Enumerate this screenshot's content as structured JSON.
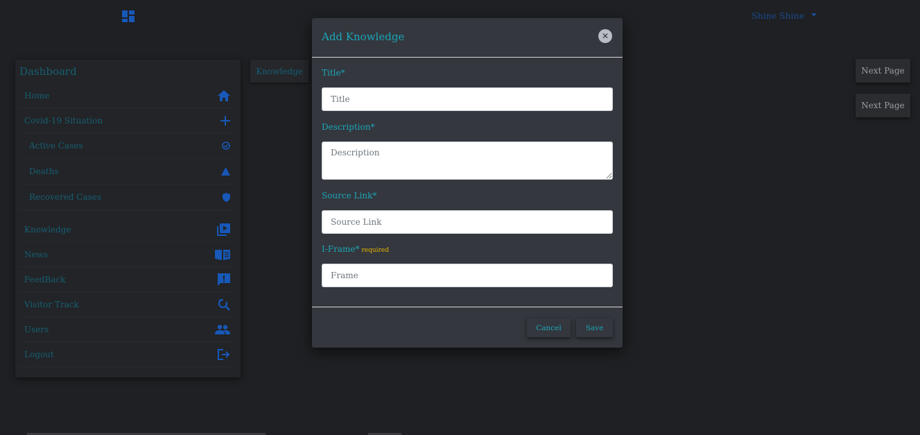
{
  "topbar": {
    "logo_icon": "dashboard-icon",
    "user_name": "Shine Shine"
  },
  "sidebar": {
    "title": "Dashboard",
    "items": [
      {
        "label": "Home",
        "icon": "home-icon"
      },
      {
        "label": "Covid-19 Situation",
        "icon": "plus-icon"
      },
      {
        "label": "Active Cases",
        "icon": "check-circle-icon"
      },
      {
        "label": "Deaths",
        "icon": "warning-triangle-icon"
      },
      {
        "label": "Recovered Cases",
        "icon": "shield-icon"
      },
      {
        "label": "Knowledge",
        "icon": "video-library-icon"
      },
      {
        "label": "News",
        "icon": "book-icon"
      },
      {
        "label": "FeedBack",
        "icon": "feedback-icon"
      },
      {
        "label": "Visitor Track",
        "icon": "search-refresh-icon"
      },
      {
        "label": "Users",
        "icon": "users-icon"
      },
      {
        "label": "Logout",
        "icon": "logout-icon"
      }
    ]
  },
  "main": {
    "tab_label": "Knowledge",
    "next_buttons": [
      "Next Page",
      "Next Page"
    ]
  },
  "modal": {
    "title": "Add Knowledge",
    "close_icon": "close-icon",
    "fields": {
      "title": {
        "label": "Title*",
        "placeholder": "Title",
        "value": ""
      },
      "description": {
        "label": "Description*",
        "placeholder": "Description",
        "value": ""
      },
      "source_link": {
        "label": "Source Link*",
        "placeholder": "Source Link",
        "value": ""
      },
      "iframe": {
        "label": "I-Frame*",
        "note": "required",
        "placeholder": "Frame",
        "value": ""
      }
    },
    "cancel_label": "Cancel",
    "save_label": "Save"
  },
  "colors": {
    "background": "#1e2023",
    "accent": "#1ba6b8",
    "sidebar_text": "#175f73",
    "sidebar_icon": "#1758b8",
    "required_note": "#e6b800"
  }
}
